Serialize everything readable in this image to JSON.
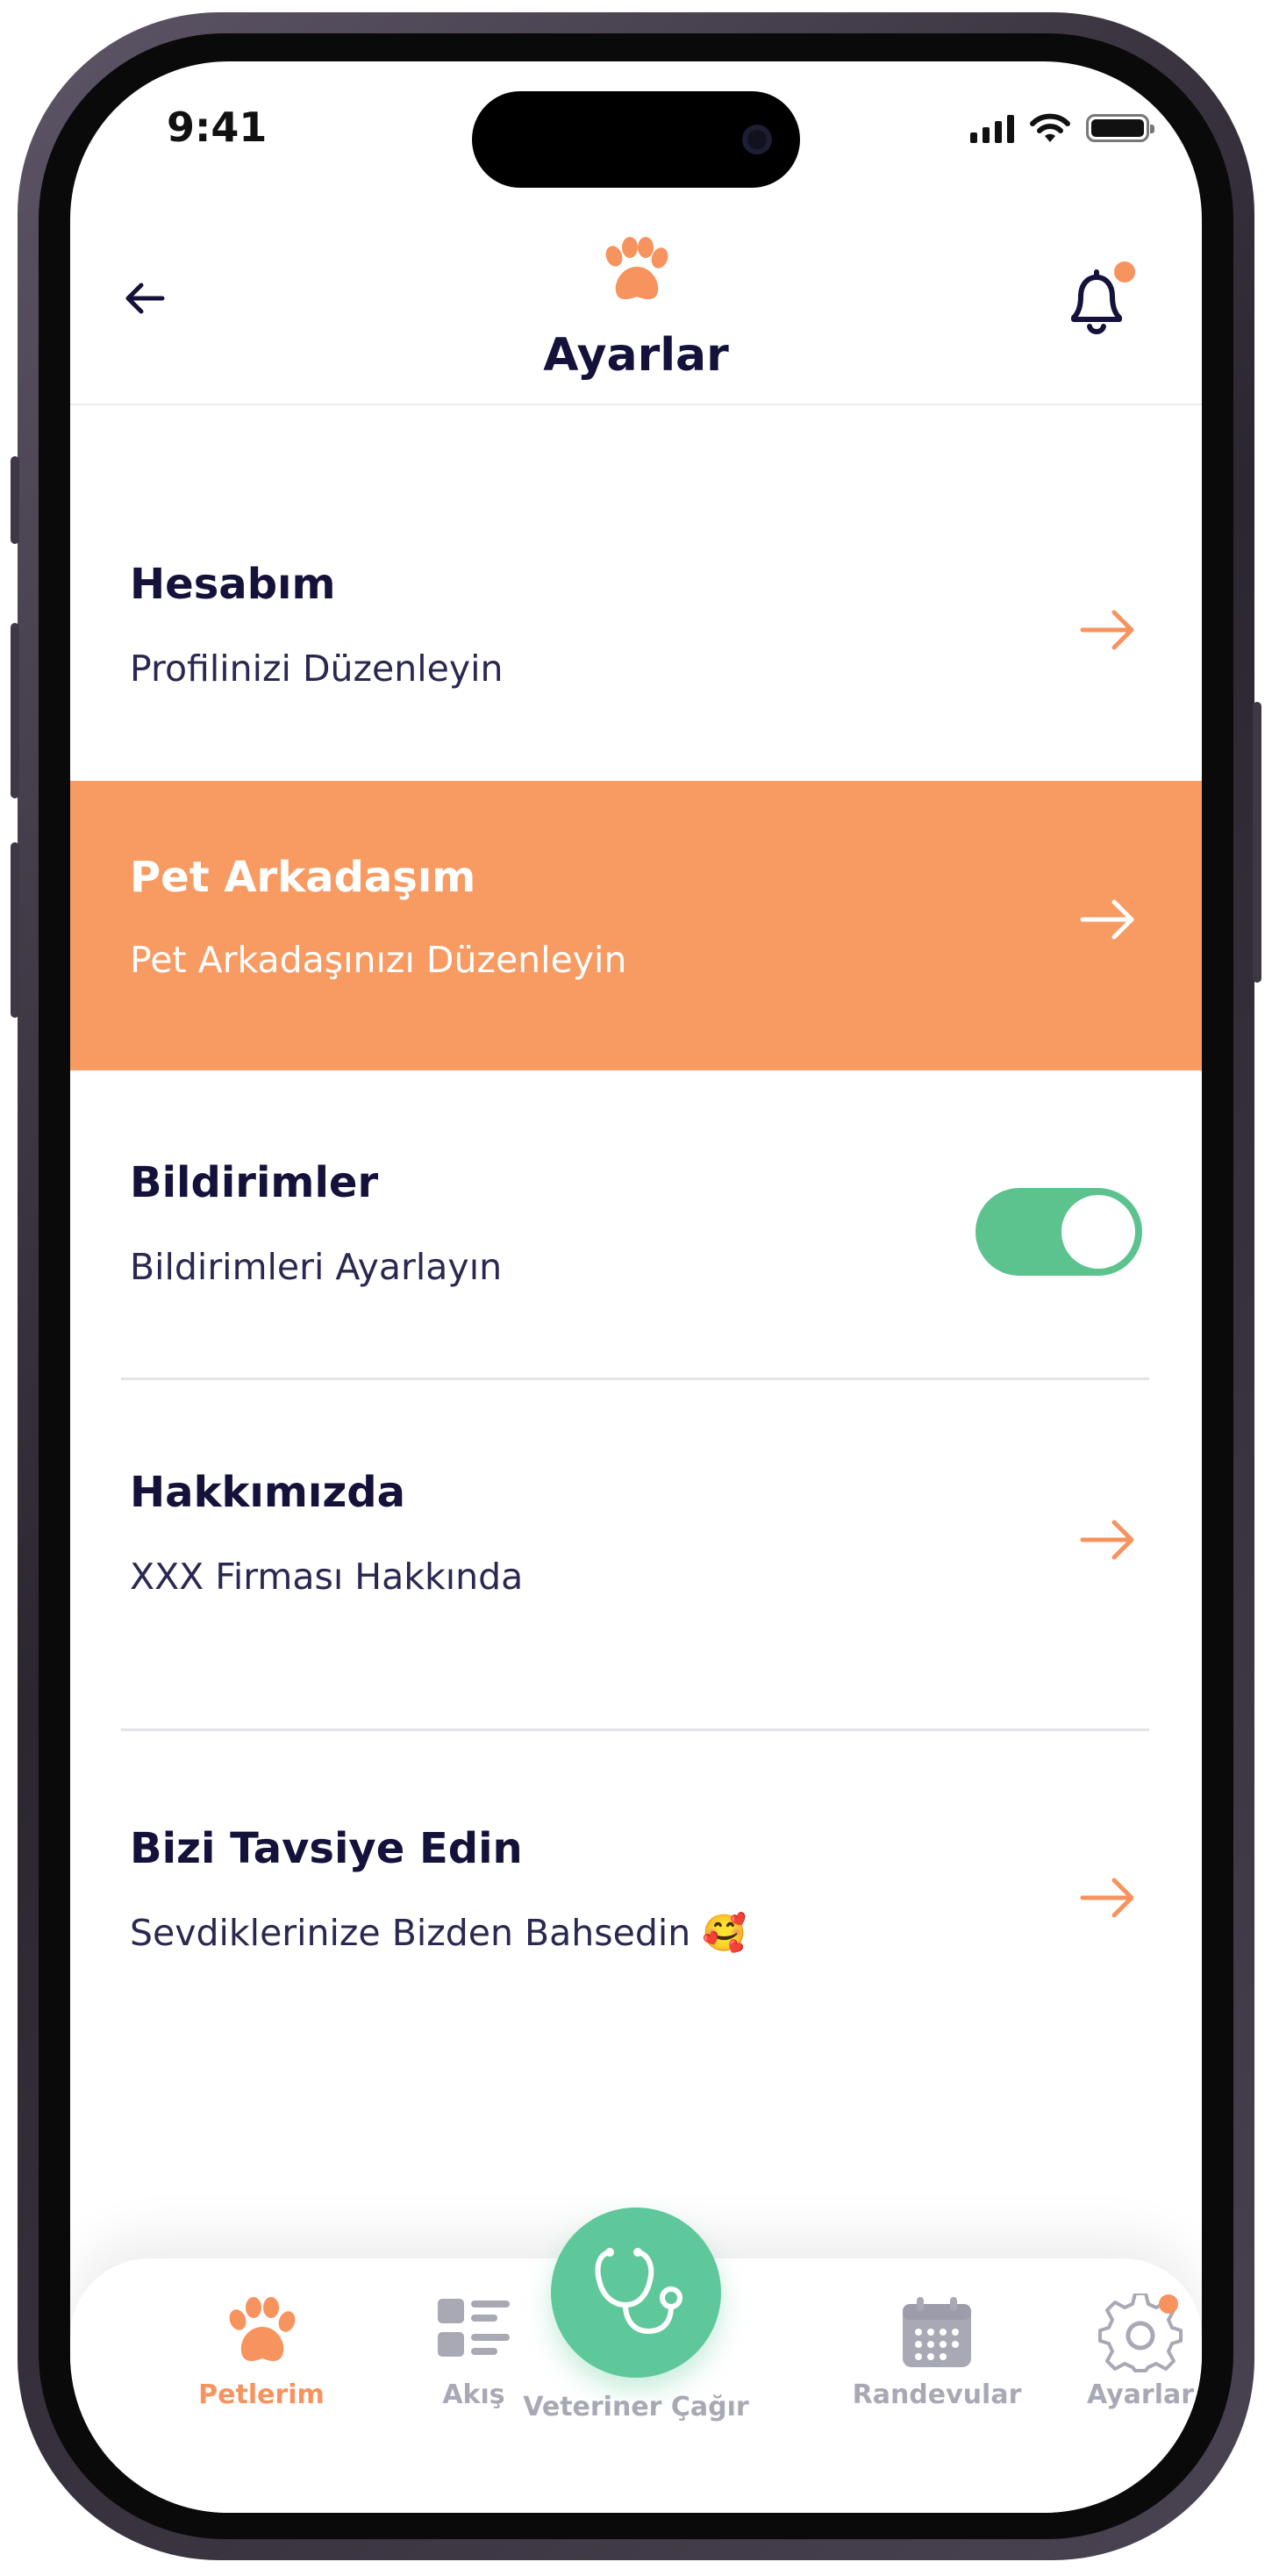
{
  "status_bar": {
    "time": "9:41"
  },
  "header": {
    "title": "Ayarlar",
    "back_icon": "arrow-left-icon",
    "logo_icon": "paw-icon",
    "notification_icon": "bell-icon"
  },
  "settings": {
    "items": [
      {
        "title": "Hesabım",
        "subtitle": "Profilinizi Düzenleyin"
      },
      {
        "title": "Pet Arkadaşım",
        "subtitle": "Pet Arkadaşınızı Düzenleyin"
      },
      {
        "title": "Bildirimler",
        "subtitle": "Bildirimleri Ayarlayın"
      },
      {
        "title": "Hakkımızda",
        "subtitle": "XXX Firması Hakkında"
      },
      {
        "title": "Bizi Tavsiye Edin",
        "subtitle": "Sevdiklerinize Bizden Bahsedin 🥰"
      }
    ],
    "notifications_enabled": true
  },
  "tabbar": {
    "tabs": [
      {
        "label": "Petlerim",
        "icon": "paw-icon"
      },
      {
        "label": "Akış",
        "icon": "feed-icon"
      },
      {
        "label": "Veteriner Çağır",
        "icon": "stethoscope-icon"
      },
      {
        "label": "Randevular",
        "icon": "calendar-icon"
      },
      {
        "label": "Ayarlar",
        "icon": "gear-icon"
      }
    ]
  },
  "colors": {
    "accent": "#f7935e",
    "active_row": "#f89b63",
    "toggle_on": "#5cc28e",
    "fab": "#5fc89a",
    "text_dark": "#14123a",
    "tab_inactive": "#a9a9b6"
  }
}
